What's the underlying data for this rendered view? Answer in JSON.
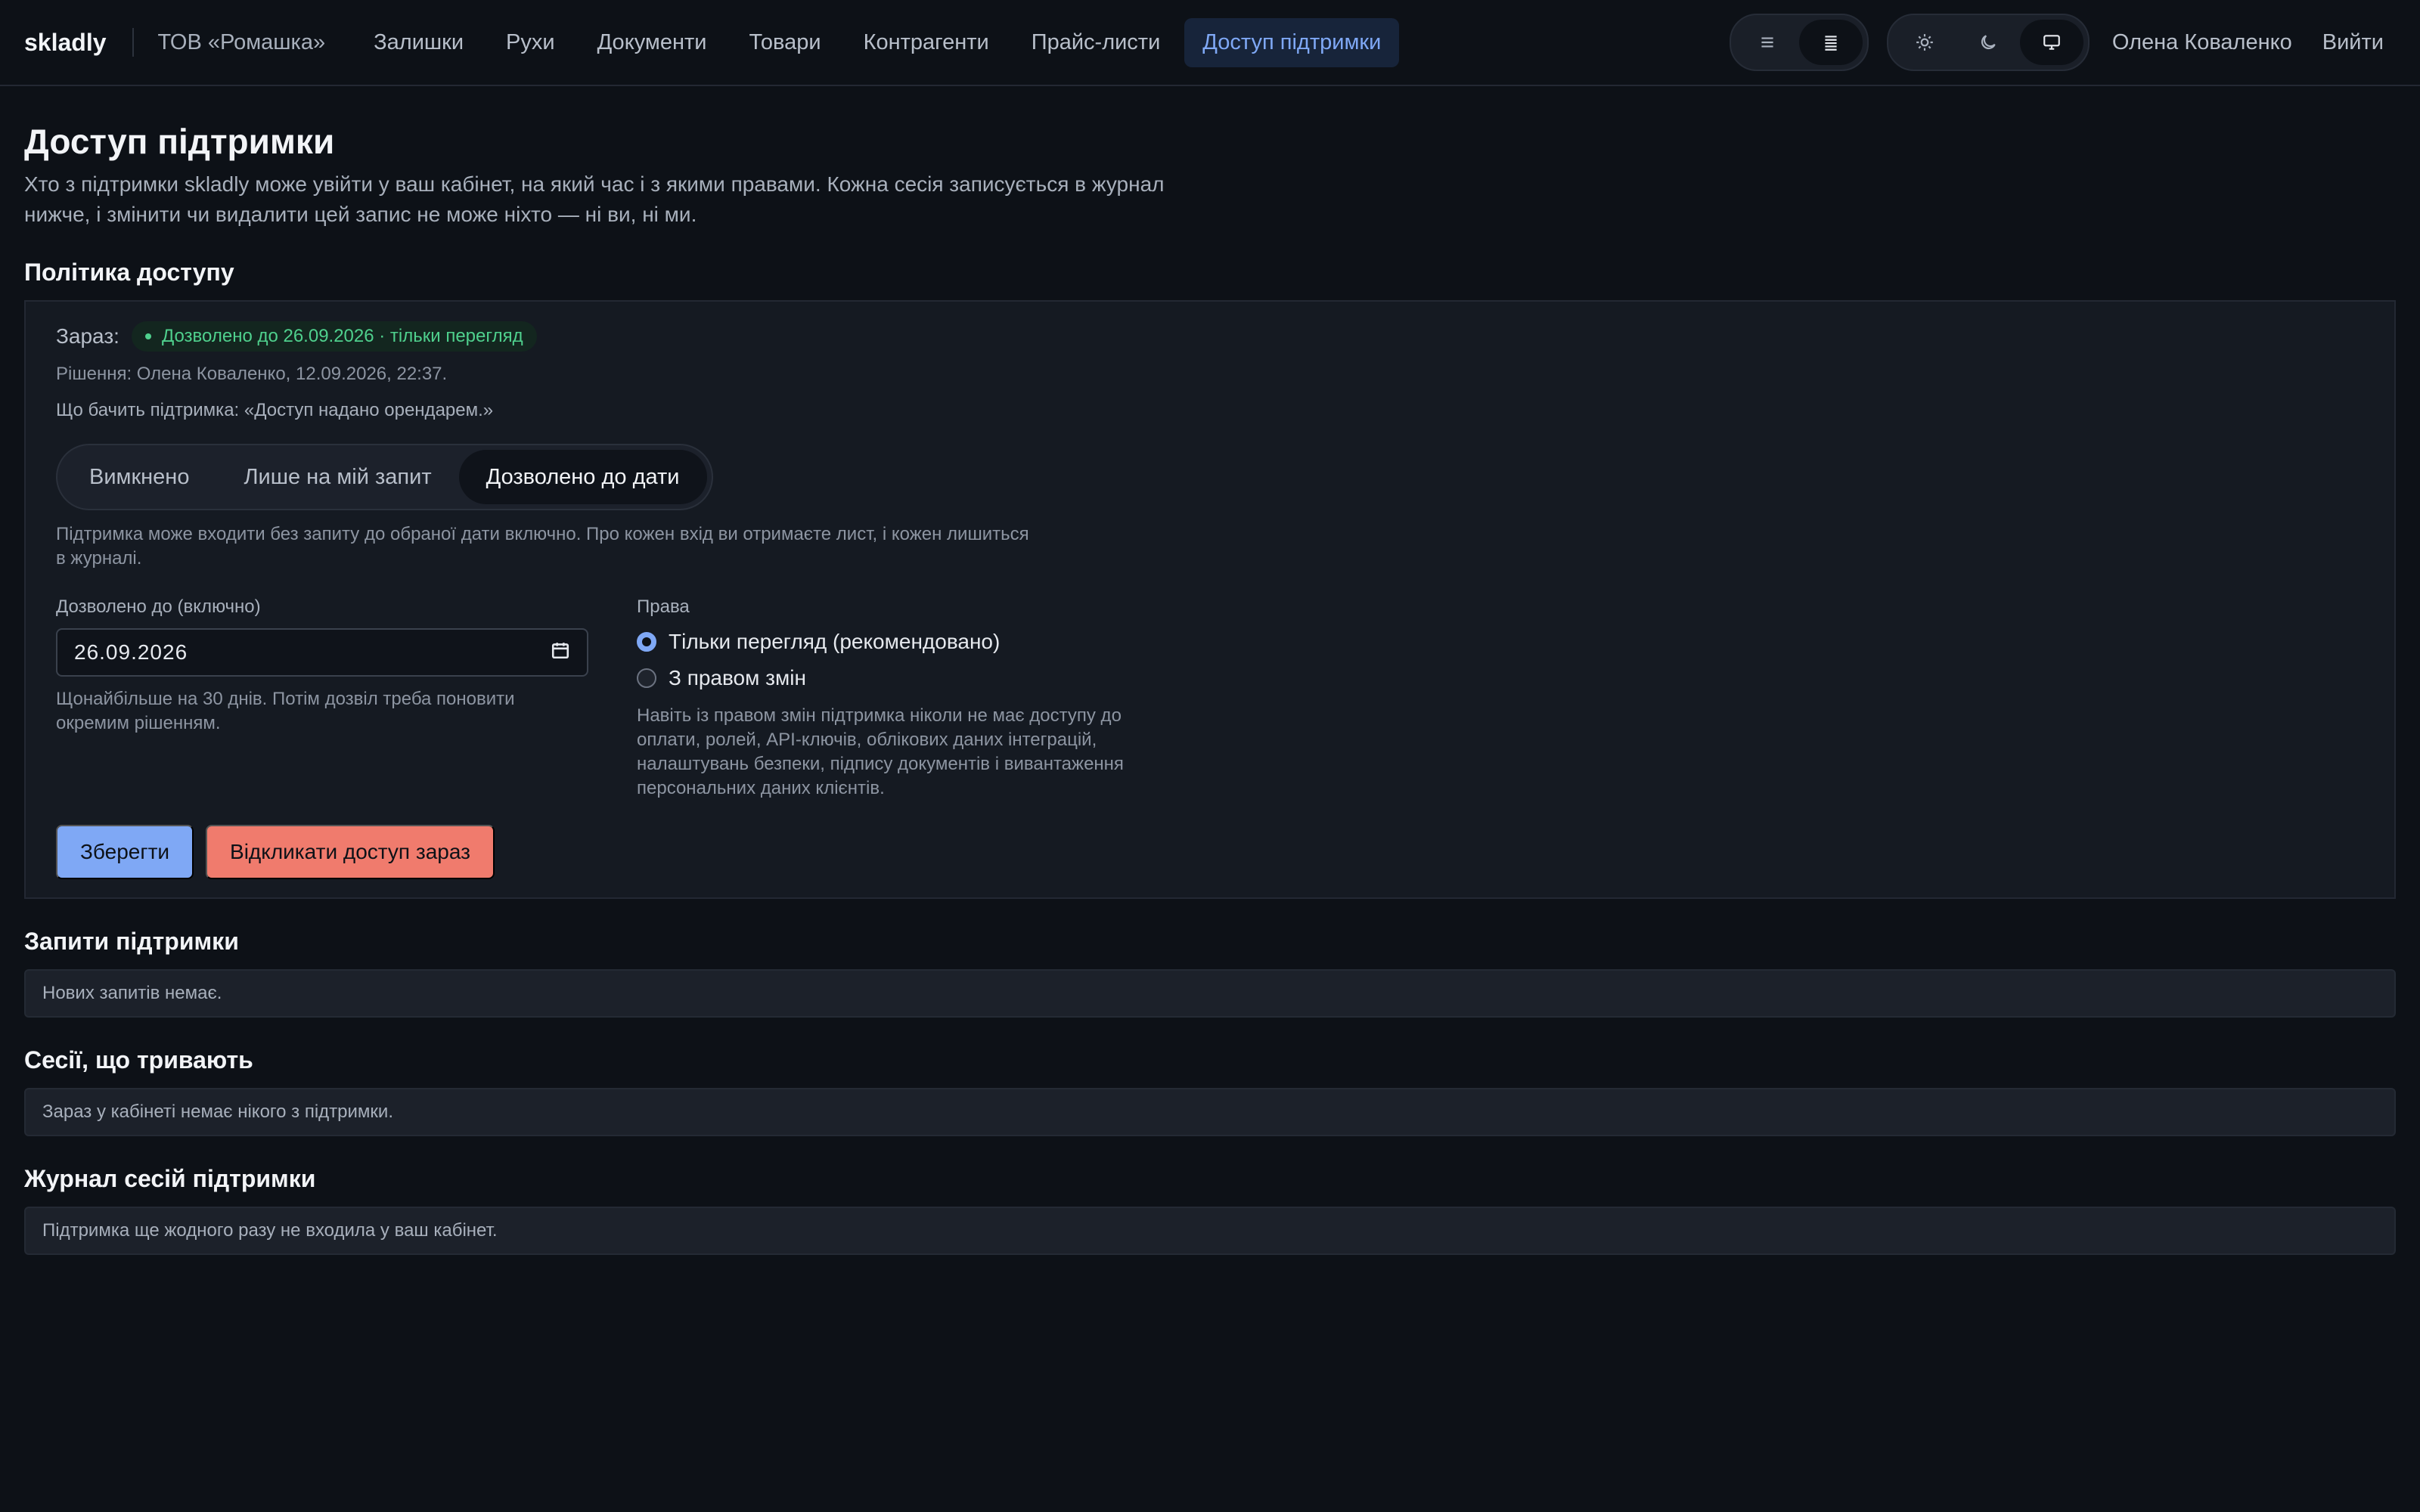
{
  "header": {
    "brand": "skladly",
    "org": "ТОВ «Ромашка»",
    "nav": [
      {
        "label": "Залишки"
      },
      {
        "label": "Рухи"
      },
      {
        "label": "Документи"
      },
      {
        "label": "Товари"
      },
      {
        "label": "Контрагенти"
      },
      {
        "label": "Прайс-листи"
      },
      {
        "label": "Доступ підтримки",
        "active": true
      }
    ],
    "density_toggle": {
      "options": [
        "list-icon",
        "list-dense-icon"
      ],
      "selected": "list-dense-icon"
    },
    "theme_toggle": {
      "options": [
        "sun-icon",
        "moon-icon",
        "monitor-icon"
      ],
      "selected": "monitor-icon"
    },
    "user": "Олена Коваленко",
    "logout": "Вийти"
  },
  "page": {
    "title": "Доступ підтримки",
    "description": "Хто з підтримки skladly може увійти у ваш кабінет, на який час і з якими правами. Кожна сесія записується в журнал нижче, і змінити чи видалити цей запис не може ніхто — ні ви, ні ми."
  },
  "policy": {
    "section_title": "Політика доступу",
    "now_label": "Зараз:",
    "status_badge": "Дозволено до 26.09.2026 · тільки перегляд",
    "status_color": "#4fd08d",
    "decision": "Рішення: Олена Коваленко, 12.09.2026, 22:37.",
    "support_sees": "Що бачить підтримка: «Доступ надано орендарем.»",
    "modes": [
      "Вимкнено",
      "Лише на мій запит",
      "Дозволено до дати"
    ],
    "selected_mode": "Дозволено до дати",
    "mode_help": "Підтримка може входити без запиту до обраної дати включно. Про кожен вхід ви отримаєте лист, і кожен лишиться в журналі.",
    "until_label": "Дозволено до (включно)",
    "until_value": "26.09.2026",
    "until_help": "Щонайбільше на 30 днів. Потім дозвіл треба поновити окремим рішенням.",
    "rights_label": "Права",
    "rights_options": [
      "Тільки перегляд (рекомендовано)",
      "З правом змін"
    ],
    "rights_selected": "Тільки перегляд (рекомендовано)",
    "rights_help": "Навіть із правом змін підтримка ніколи не має доступу до оплати, ролей, API-ключів, облікових даних інтеграцій, налаштувань безпеки, підпису документів і вивантаження персональних даних клієнтів.",
    "save_label": "Зберегти",
    "revoke_label": "Відкликати доступ зараз",
    "accent_color": "#7fa8f5",
    "danger_color": "#f07b6d"
  },
  "requests": {
    "title": "Запити підтримки",
    "empty": "Нових запитів немає."
  },
  "sessions": {
    "title": "Сесії, що тривають",
    "empty": "Зараз у кабінеті немає нікого з підтримки."
  },
  "log": {
    "title": "Журнал сесій підтримки",
    "empty": "Підтримка ще жодного разу не входила у ваш кабінет."
  }
}
